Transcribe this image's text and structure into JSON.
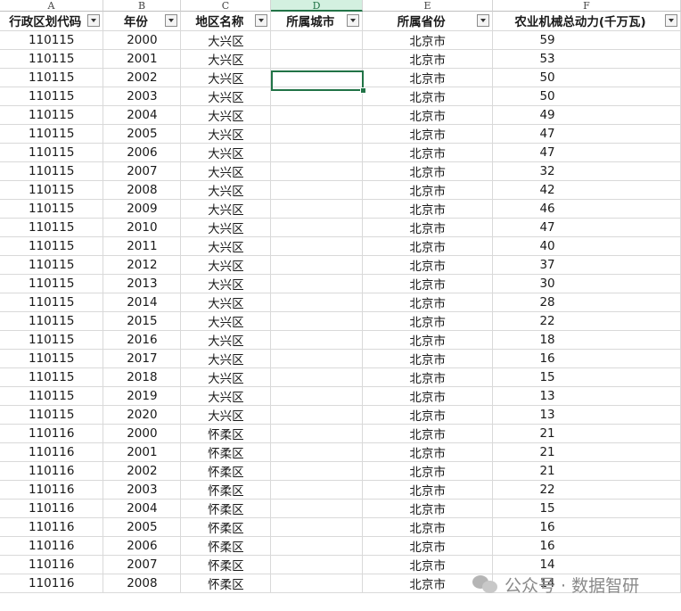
{
  "columns": [
    "A",
    "B",
    "C",
    "D",
    "E",
    "F"
  ],
  "header": [
    "行政区划代码",
    "年份",
    "地区名称",
    "所属城市",
    "所属省份",
    "农业机械总动力(千万瓦)"
  ],
  "rows": [
    [
      "110115",
      "2000",
      "大兴区",
      "",
      "北京市",
      "59"
    ],
    [
      "110115",
      "2001",
      "大兴区",
      "",
      "北京市",
      "53"
    ],
    [
      "110115",
      "2002",
      "大兴区",
      "",
      "北京市",
      "50"
    ],
    [
      "110115",
      "2003",
      "大兴区",
      "",
      "北京市",
      "50"
    ],
    [
      "110115",
      "2004",
      "大兴区",
      "",
      "北京市",
      "49"
    ],
    [
      "110115",
      "2005",
      "大兴区",
      "",
      "北京市",
      "47"
    ],
    [
      "110115",
      "2006",
      "大兴区",
      "",
      "北京市",
      "47"
    ],
    [
      "110115",
      "2007",
      "大兴区",
      "",
      "北京市",
      "32"
    ],
    [
      "110115",
      "2008",
      "大兴区",
      "",
      "北京市",
      "42"
    ],
    [
      "110115",
      "2009",
      "大兴区",
      "",
      "北京市",
      "46"
    ],
    [
      "110115",
      "2010",
      "大兴区",
      "",
      "北京市",
      "47"
    ],
    [
      "110115",
      "2011",
      "大兴区",
      "",
      "北京市",
      "40"
    ],
    [
      "110115",
      "2012",
      "大兴区",
      "",
      "北京市",
      "37"
    ],
    [
      "110115",
      "2013",
      "大兴区",
      "",
      "北京市",
      "30"
    ],
    [
      "110115",
      "2014",
      "大兴区",
      "",
      "北京市",
      "28"
    ],
    [
      "110115",
      "2015",
      "大兴区",
      "",
      "北京市",
      "22"
    ],
    [
      "110115",
      "2016",
      "大兴区",
      "",
      "北京市",
      "18"
    ],
    [
      "110115",
      "2017",
      "大兴区",
      "",
      "北京市",
      "16"
    ],
    [
      "110115",
      "2018",
      "大兴区",
      "",
      "北京市",
      "15"
    ],
    [
      "110115",
      "2019",
      "大兴区",
      "",
      "北京市",
      "13"
    ],
    [
      "110115",
      "2020",
      "大兴区",
      "",
      "北京市",
      "13"
    ],
    [
      "110116",
      "2000",
      "怀柔区",
      "",
      "北京市",
      "21"
    ],
    [
      "110116",
      "2001",
      "怀柔区",
      "",
      "北京市",
      "21"
    ],
    [
      "110116",
      "2002",
      "怀柔区",
      "",
      "北京市",
      "21"
    ],
    [
      "110116",
      "2003",
      "怀柔区",
      "",
      "北京市",
      "22"
    ],
    [
      "110116",
      "2004",
      "怀柔区",
      "",
      "北京市",
      "15"
    ],
    [
      "110116",
      "2005",
      "怀柔区",
      "",
      "北京市",
      "16"
    ],
    [
      "110116",
      "2006",
      "怀柔区",
      "",
      "北京市",
      "16"
    ],
    [
      "110116",
      "2007",
      "怀柔区",
      "",
      "北京市",
      "14"
    ],
    [
      "110116",
      "2008",
      "怀柔区",
      "",
      "北京市",
      "14"
    ]
  ],
  "selected_cell": "D3",
  "watermark": "公众号 · 数据智研",
  "colors": {
    "accent": "#217346",
    "gridline": "#d9d9d9"
  }
}
